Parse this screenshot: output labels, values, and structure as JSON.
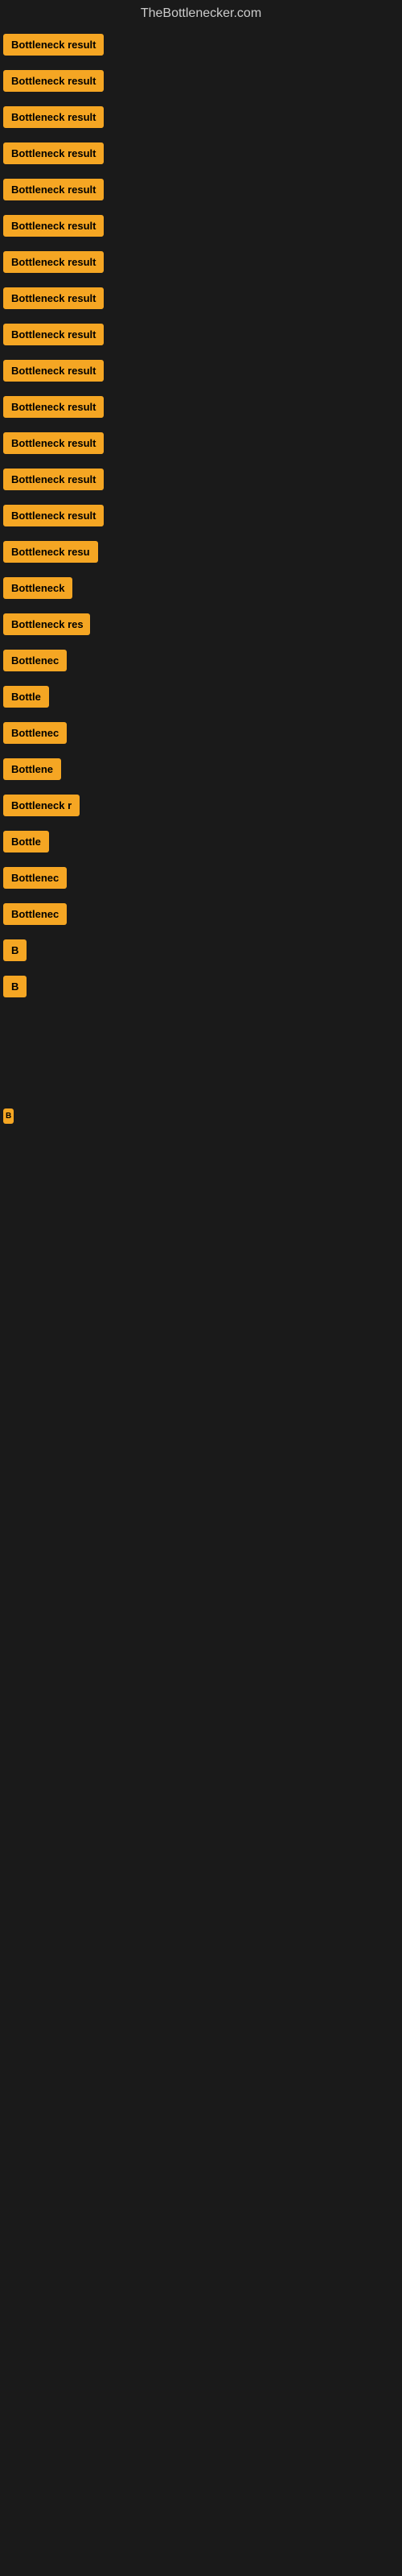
{
  "site": {
    "title": "TheBottlenecker.com"
  },
  "items": [
    {
      "id": 1,
      "label": "Bottleneck result",
      "class": "item-1"
    },
    {
      "id": 2,
      "label": "Bottleneck result",
      "class": "item-2"
    },
    {
      "id": 3,
      "label": "Bottleneck result",
      "class": "item-3"
    },
    {
      "id": 4,
      "label": "Bottleneck result",
      "class": "item-4"
    },
    {
      "id": 5,
      "label": "Bottleneck result",
      "class": "item-5"
    },
    {
      "id": 6,
      "label": "Bottleneck result",
      "class": "item-6"
    },
    {
      "id": 7,
      "label": "Bottleneck result",
      "class": "item-7"
    },
    {
      "id": 8,
      "label": "Bottleneck result",
      "class": "item-8"
    },
    {
      "id": 9,
      "label": "Bottleneck result",
      "class": "item-9"
    },
    {
      "id": 10,
      "label": "Bottleneck result",
      "class": "item-10"
    },
    {
      "id": 11,
      "label": "Bottleneck result",
      "class": "item-11"
    },
    {
      "id": 12,
      "label": "Bottleneck result",
      "class": "item-12"
    },
    {
      "id": 13,
      "label": "Bottleneck result",
      "class": "item-13"
    },
    {
      "id": 14,
      "label": "Bottleneck result",
      "class": "item-14"
    },
    {
      "id": 15,
      "label": "Bottleneck resu",
      "class": "item-15"
    },
    {
      "id": 16,
      "label": "Bottleneck",
      "class": "item-16"
    },
    {
      "id": 17,
      "label": "Bottleneck res",
      "class": "item-17"
    },
    {
      "id": 18,
      "label": "Bottlenec",
      "class": "item-18"
    },
    {
      "id": 19,
      "label": "Bottle",
      "class": "item-19"
    },
    {
      "id": 20,
      "label": "Bottlenec",
      "class": "item-20"
    },
    {
      "id": 21,
      "label": "Bottlene",
      "class": "item-21"
    },
    {
      "id": 22,
      "label": "Bottleneck r",
      "class": "item-22"
    },
    {
      "id": 23,
      "label": "Bottle",
      "class": "item-23"
    },
    {
      "id": 24,
      "label": "Bottlenec",
      "class": "item-24"
    },
    {
      "id": 25,
      "label": "Bottlenec",
      "class": "item-25"
    },
    {
      "id": 26,
      "label": "B",
      "class": "item-26"
    },
    {
      "id": 27,
      "label": "B",
      "class": "item-27"
    },
    {
      "id": 28,
      "label": "B",
      "class": "item-28"
    }
  ],
  "colors": {
    "badge_bg": "#f5a623",
    "badge_text": "#000000",
    "page_bg": "#1a1a1a",
    "title_color": "#cccccc"
  }
}
